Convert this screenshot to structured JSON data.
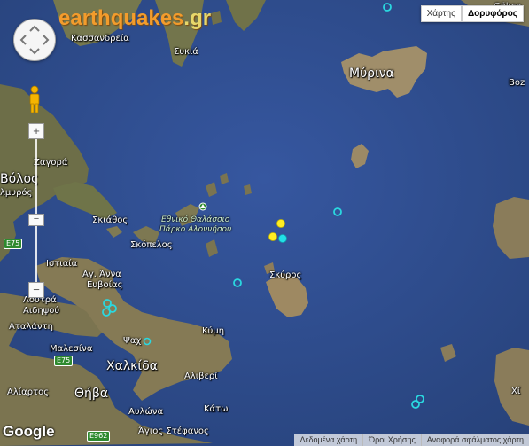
{
  "branding": {
    "logo_main": "earthquakes",
    "logo_suffix": ".gr",
    "google_logo": "Google"
  },
  "map_type": {
    "map_label": "Χάρτης",
    "satellite_label": "Δορυφόρος",
    "active": "satellite"
  },
  "controls": {
    "zoom_in": "+",
    "zoom_out": "−",
    "zoom_level_fraction": 0.06
  },
  "footer": {
    "map_data": "Δεδομένα χάρτη",
    "terms": "Όροι Χρήσης",
    "report": "Αναφορά σφάλματος χάρτη"
  },
  "places": {
    "kassandreia": "Κασσανδρεία",
    "sykia": "Συκιά",
    "myrina": "Μύρινα",
    "boz": "Boz",
    "zagora": "Ζαγορά",
    "volos": "Βόλος",
    "almyros": "λμυρός",
    "skiathos": "Σκιάθος",
    "skopelos": "Σκόπελος",
    "park_line1": "Εθνικό Θαλάσσιο",
    "park_line2": "Πάρκο Αλοννήσου",
    "skyros": "Σκύρος",
    "istiaia": "Ιστιαία",
    "agia_anna_1": "Αγ. Άννα",
    "agia_anna_2": "Ευβοίας",
    "loutra_1": "Λουτρά",
    "loutra_2": "Αιδηψού",
    "psachna": "Ψαχ",
    "atalanti": "Αταλάντη",
    "kymi": "Κύμη",
    "malesina": "Μαλεσίνα",
    "chalkida": "Χαλκίδα",
    "aliveri": "Αλιβερί",
    "thiva": "Θήβα",
    "aliartos": "Αλίαρτος",
    "avlona": "Αυλώνα",
    "kato": "Κάτω",
    "agios_stefanos": "Άγιος Στέφανος",
    "gokce": "Gökçe",
    "xio": "Χί"
  },
  "roads": {
    "e75": "E75",
    "e962": "E962"
  },
  "earthquakes": [
    {
      "type": "recent",
      "color": "#ffee22"
    },
    {
      "type": "recent",
      "color": "#ffee22"
    },
    {
      "type": "recent-strong",
      "color": "#22e0e8"
    },
    {
      "type": "older",
      "color": "#2ad8e0"
    },
    {
      "type": "older",
      "color": "#2ad8e0"
    },
    {
      "type": "older",
      "color": "#2ad8e0"
    },
    {
      "type": "older",
      "color": "#2ad8e0"
    },
    {
      "type": "older",
      "color": "#2ad8e0"
    },
    {
      "type": "older",
      "color": "#2ad8e0"
    },
    {
      "type": "older",
      "color": "#2ad8e0"
    }
  ],
  "colors": {
    "sea": "#2d4c86",
    "land": "#7a7a55",
    "island": "#9a8a68",
    "logo": "#f39c2c"
  }
}
